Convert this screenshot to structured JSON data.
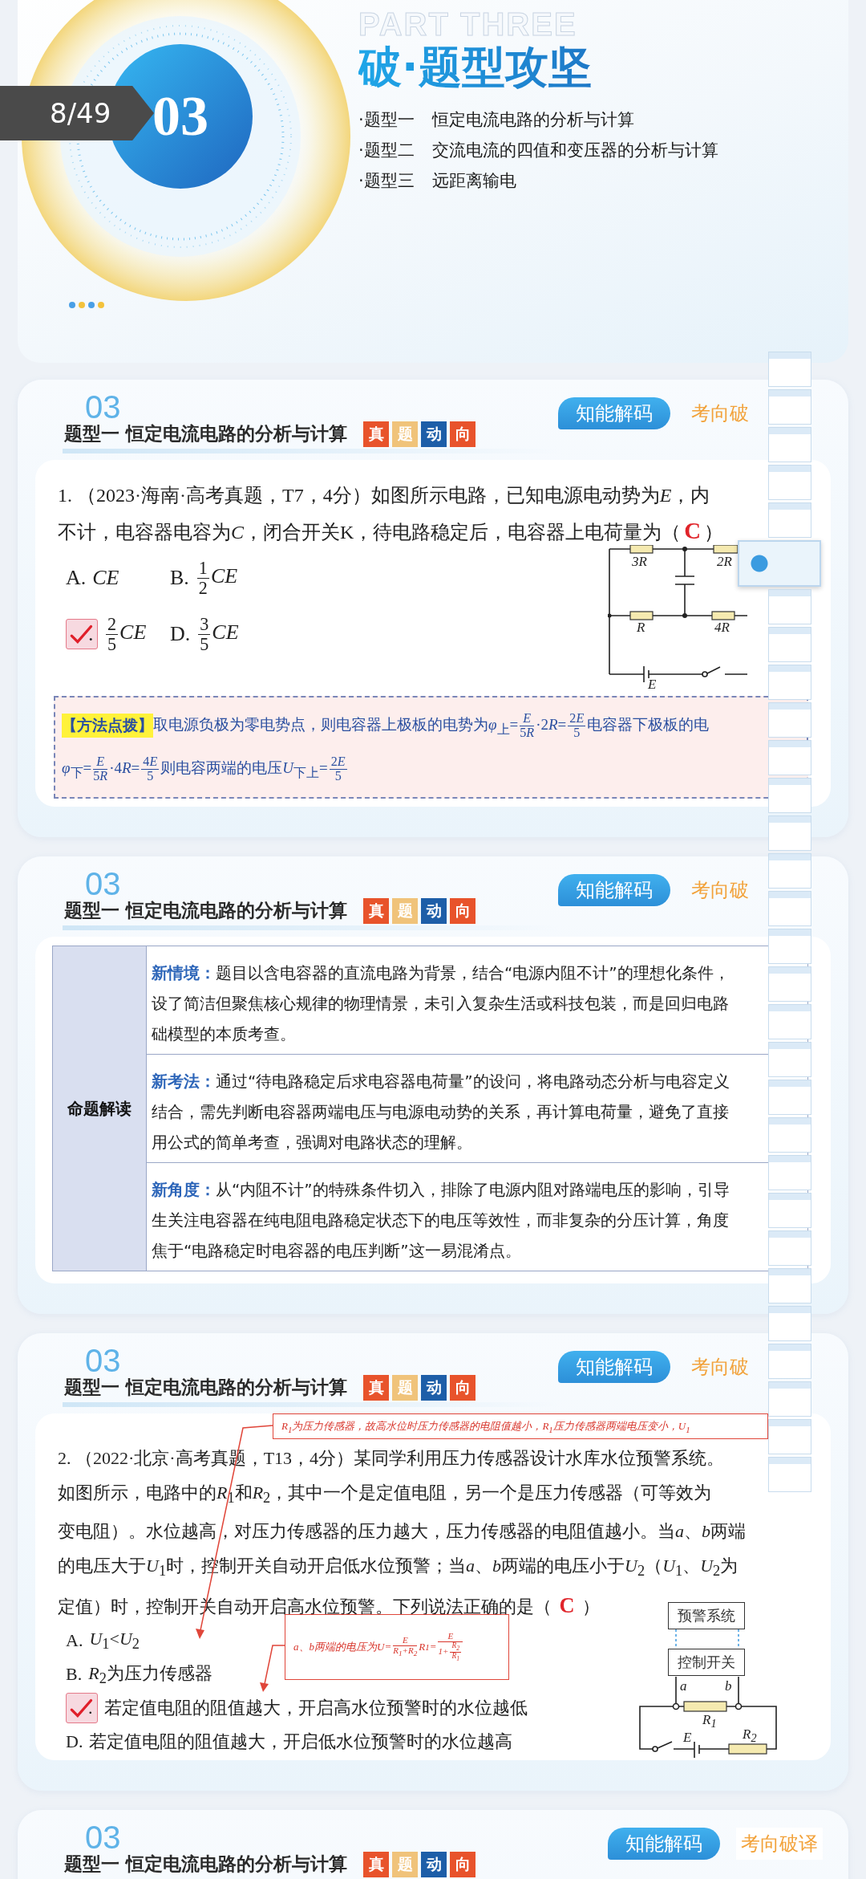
{
  "page_counter": "8/49",
  "cover": {
    "part": "PART THREE",
    "number": "03",
    "title": "破·题型攻坚",
    "topics": [
      {
        "label": "·题型一",
        "text": "恒定电流电路的分析与计算"
      },
      {
        "label": "·题型二",
        "text": "交流电流的四值和变压器的分析与计算"
      },
      {
        "label": "·题型三",
        "text": "远距离输电"
      }
    ]
  },
  "slides": [
    {
      "header": {
        "number": "03",
        "title": "题型一 恒定电流电路的分析与计算",
        "tags": [
          {
            "text": "真",
            "color": "#e8532b"
          },
          {
            "text": "题",
            "color": "#f0c37a"
          },
          {
            "text": "动",
            "color": "#1d5ea8"
          },
          {
            "text": "向",
            "color": "#e8532b"
          }
        ],
        "tabs": [
          {
            "label": "知能解码",
            "selected": true
          },
          {
            "label": "考向破",
            "selected": false
          }
        ]
      },
      "body": {
        "kind": "choice_grid",
        "lines": [
          [
            "1. （2023·海南·高考真题，T7，4分）如图所示电路，已知电源电动势为",
            {
              "i": "E"
            },
            "，内"
          ],
          [
            "不计，电容器电容为",
            {
              "i": "C"
            },
            "，闭合开关K，待电路稳定后，电容器上电荷量为（",
            {
              "answer": "C"
            },
            "）"
          ]
        ],
        "options": [
          {
            "letter": "A.",
            "segments": [
              {
                "i": "CE"
              }
            ],
            "selected": false
          },
          {
            "letter": "B.",
            "segments": [
              {
                "num": "1",
                "den": "2"
              },
              {
                "i": "CE"
              }
            ],
            "selected": false
          },
          {
            "letter": ".",
            "segments": [
              {
                "num": "2",
                "den": "5"
              },
              {
                "i": "CE"
              }
            ],
            "selected": true
          },
          {
            "letter": "D.",
            "segments": [
              {
                "num": "3",
                "den": "5"
              },
              {
                "i": "CE"
              }
            ],
            "selected": false
          }
        ],
        "figure": {
          "kind": "rc_circuit",
          "labels": [
            [
              "3",
              {
                "i": "R"
              }
            ],
            [
              "2",
              {
                "i": "R"
              }
            ],
            [
              {
                "i": "R"
              }
            ],
            [
              "4",
              {
                "i": "R"
              }
            ],
            [
              {
                "i": "E"
              }
            ]
          ]
        },
        "method": {
          "label": "【方法点拨】",
          "lines": [
            [
              "取电源负极为零电势点，则电容器上极板的电势为",
              {
                "i": "φ"
              },
              "$_{上}$=",
              {
                "num": [
                  {
                    "i": "E"
                  }
                ],
                "den": [
                  "5",
                  {
                    "i": "R"
                  }
                ]
              },
              "·2",
              {
                "i": "R"
              },
              "=",
              {
                "num": [
                  "2",
                  {
                    "i": "E"
                  }
                ],
                "den": "5"
              },
              "电容器下极板的电"
            ],
            [
              {
                "i": "φ"
              },
              "$_{下}$=",
              {
                "num": [
                  {
                    "i": "E"
                  }
                ],
                "den": [
                  "5",
                  {
                    "i": "R"
                  }
                ]
              },
              "·4",
              {
                "i": "R"
              },
              "=",
              {
                "num": [
                  "4",
                  {
                    "i": "E"
                  }
                ],
                "den": "5"
              },
              "则电容两端的电压",
              {
                "i": "U"
              },
              "$_{下上}$=",
              {
                "num": [
                  "2",
                  {
                    "i": "E"
                  }
                ],
                "den": "5"
              }
            ]
          ]
        }
      }
    },
    {
      "header": {
        "number": "03",
        "title": "题型一 恒定电流电路的分析与计算",
        "tags": [
          {
            "text": "真",
            "color": "#e8532b"
          },
          {
            "text": "题",
            "color": "#f0c37a"
          },
          {
            "text": "动",
            "color": "#1d5ea8"
          },
          {
            "text": "向",
            "color": "#e8532b"
          }
        ],
        "tabs": [
          {
            "label": "知能解码",
            "selected": true
          },
          {
            "label": "考向破",
            "selected": false
          }
        ]
      },
      "body": {
        "kind": "analysis_table",
        "heading": "命题解读",
        "rows": [
          {
            "label": "新情境：",
            "lines": [
              "题目以含电容器的直流电路为背景，结合“电源内阻不计”的理想化条件，",
              "设了简洁但聚焦核心规律的物理情景，未引入复杂生活或科技包装，而是回归电路",
              "础模型的本质考查。"
            ]
          },
          {
            "label": "新考法：",
            "lines": [
              "通过“待电路稳定后求电容器电荷量”的设问，将电路动态分析与电容定义",
              "结合，需先判断电容器两端电压与电源电动势的关系，再计算电荷量，避免了直接",
              "用公式的简单考查，强调对电路状态的理解。"
            ]
          },
          {
            "label": "新角度：",
            "lines": [
              "从“内阻不计”的特殊条件切入，排除了电源内阻对路端电压的影响，引导",
              "生关注电容器在纯电阻电路稳定状态下的电压等效性，而非复杂的分压计算，角度",
              "焦于“电路稳定时电容器的电压判断”这一易混淆点。"
            ]
          }
        ]
      }
    },
    {
      "header": {
        "number": "03",
        "title": "题型一 恒定电流电路的分析与计算",
        "tags": [
          {
            "text": "真",
            "color": "#e8532b"
          },
          {
            "text": "题",
            "color": "#f0c37a"
          },
          {
            "text": "动",
            "color": "#1d5ea8"
          },
          {
            "text": "向",
            "color": "#e8532b"
          }
        ],
        "tabs": [
          {
            "label": "知能解码",
            "selected": true
          },
          {
            "label": "考向破",
            "selected": false
          }
        ]
      },
      "body": {
        "kind": "choice_list",
        "lines": [
          [
            "2. （2022·北京·高考真题，T13，4分）某同学利用压力传感器设计水库水位预警系统。"
          ],
          [
            "如图所示，电路中的",
            {
              "i": "R"
            },
            "$_{1}$和",
            {
              "i": "R"
            },
            "$_{2}$，其中一个是定值电阻，另一个是压力传感器（可等效为"
          ],
          [
            "变电阻）。水位越高，对压力传感器的压力越大，压力传感器的电阻值越小。当",
            {
              "i": "a"
            },
            "、",
            {
              "i": "b"
            },
            "两端"
          ],
          [
            "的电压大于",
            {
              "i": "U"
            },
            "$_{1}$时，控制开关自动开启低水位预警；当",
            {
              "i": "a"
            },
            "、",
            {
              "i": "b"
            },
            "两端的电压小于",
            {
              "i": "U"
            },
            "$_{2}$（",
            {
              "i": "U"
            },
            "$_{1}$、",
            {
              "i": "U"
            },
            "$_{2}$为"
          ],
          [
            "定值）时，控制开关自动开启高水位预警。下列说法正确的是（ ",
            {
              "answer": "C"
            },
            " ）"
          ]
        ],
        "options": [
          {
            "letter": "A.",
            "segments": [
              {
                "i": "U"
              },
              "$_{1}$<",
              {
                "i": "U"
              },
              "$_{2}$"
            ],
            "selected": false
          },
          {
            "letter": "B.",
            "segments": [
              {
                "i": "R"
              },
              "$_{2}$为压力传感器"
            ],
            "selected": false
          },
          {
            "letter": ".",
            "segments": [
              "若定值电阻的阻值越大，开启高水位预警时的水位越低"
            ],
            "selected": true
          },
          {
            "letter": "D.",
            "segments": [
              "若定值电阻的阻值越大，开启低水位预警时的水位越高"
            ],
            "selected": false
          }
        ],
        "figure": {
          "kind": "alarm_circuit",
          "boxes": [
            "预警系统",
            "控制开关"
          ],
          "labels": [
            [
              {
                "i": "a"
              }
            ],
            [
              {
                "i": "b"
              }
            ],
            [
              {
                "i": "R"
              },
              "$_{1}$"
            ],
            [
              {
                "i": "R"
              },
              "$_{2}$"
            ],
            [
              {
                "i": "E"
              }
            ]
          ]
        },
        "annotations": [
          {
            "segments": [
              {
                "i": "R"
              },
              "$_{1}$为压力传感器，故高水位时压力传感器的电阻值越小，",
              {
                "i": "R"
              },
              "$_{1}$压力传感器两端电压变小，",
              {
                "i": "U"
              },
              "$_{1}$"
            ]
          },
          {
            "segments": [
              {
                "i": "a"
              },
              "、",
              {
                "i": "b"
              },
              "两端的电压为",
              {
                "i": "U"
              },
              "=",
              {
                "num": [
                  {
                    "i": "E"
                  }
                ],
                "den": [
                  {
                    "i": "R"
                  },
                  "$_{1}$+",
                  {
                    "i": "R"
                  },
                  "$_{2}$"
                ]
              },
              {
                "i": "R"
              },
              "$_{1}$=",
              {
                "num": [
                  {
                    "i": "E"
                  }
                ],
                "den": [
                  "1+",
                  {
                    "num": [
                      {
                        "i": "R"
                      },
                      "$_{2}$"
                    ],
                    "den": [
                      {
                        "i": "R"
                      },
                      "$_{1}$"
                    ]
                  }
                ]
              }
            ]
          }
        ]
      }
    },
    {
      "header": {
        "number": "03",
        "title": "题型一 恒定电流电路的分析与计算",
        "tags": [
          {
            "text": "真",
            "color": "#e8532b"
          },
          {
            "text": "题",
            "color": "#f0c37a"
          },
          {
            "text": "动",
            "color": "#1d5ea8"
          },
          {
            "text": "向",
            "color": "#e8532b"
          }
        ],
        "tabs": [
          {
            "label": "知能解码",
            "selected": true
          },
          {
            "label": "考向破译",
            "selected": false
          }
        ]
      }
    }
  ],
  "thumbnails": [
    {
      "selected": false
    },
    {
      "selected": false
    },
    {
      "selected": false
    },
    {
      "selected": false
    },
    {
      "selected": false
    },
    {
      "selected": true
    },
    {
      "selected": false
    },
    {
      "selected": false
    },
    {
      "selected": false
    },
    {
      "selected": false
    },
    {
      "selected": false
    },
    {
      "selected": false
    },
    {
      "selected": false
    },
    {
      "selected": false
    },
    {
      "selected": false
    },
    {
      "selected": false
    },
    {
      "selected": false
    },
    {
      "selected": false
    },
    {
      "selected": false
    },
    {
      "selected": false
    },
    {
      "selected": false
    },
    {
      "selected": false
    },
    {
      "selected": false
    },
    {
      "selected": false
    },
    {
      "selected": false
    },
    {
      "selected": false
    },
    {
      "selected": false
    },
    {
      "selected": false
    },
    {
      "selected": false
    },
    {
      "selected": false
    }
  ]
}
